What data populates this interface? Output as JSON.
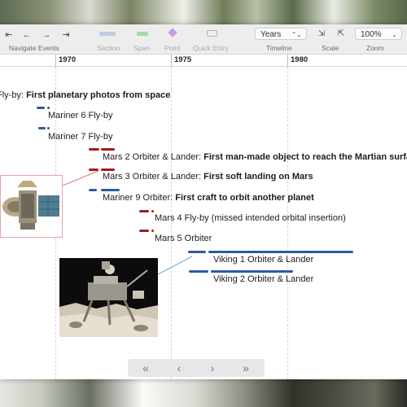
{
  "toolbar": {
    "navigate_label": "Navigate Events",
    "section_label": "Section",
    "span_label": "Span",
    "point_label": "Point",
    "quick_entry_label": "Quick Entry",
    "timeline_label": "Timeline",
    "scale_label": "Scale",
    "zoom_label": "Zoom",
    "timeline_value": "Years",
    "zoom_value": "100%",
    "colors": {
      "span": "#a8d8a8",
      "point": "#c79be0",
      "section": "#b9c6e8"
    }
  },
  "ruler": {
    "years": [
      "1970",
      "1975",
      "1980"
    ]
  },
  "events": [
    {
      "id": "e1",
      "prefix": "Fly-by: ",
      "bold": "First planetary photos from space",
      "color": ""
    },
    {
      "id": "e2",
      "label": "Mariner 6 Fly-by",
      "color": "blue"
    },
    {
      "id": "e3",
      "label": "Mariner 7 Fly-by",
      "color": "blue"
    },
    {
      "id": "e4",
      "prefix": "Mars 2 Orbiter & Lander: ",
      "bold": "First man-made object to reach the Martian surface",
      "color": "red"
    },
    {
      "id": "e5",
      "prefix": "Mars 3 Orbiter & Lander: ",
      "bold": "First soft landing on Mars",
      "color": "red"
    },
    {
      "id": "e6",
      "prefix": "Mariner 9 Orbiter: ",
      "bold": "First craft to orbit another planet",
      "color": "blue"
    },
    {
      "id": "e7",
      "label": "Mars 4 Fly-by (missed intended orbital insertion)",
      "color": "red"
    },
    {
      "id": "e8",
      "label": "Mars 5 Orbiter",
      "color": "red"
    },
    {
      "id": "e9",
      "label": "Viking 1 Orbiter & Lander",
      "color": "blue"
    },
    {
      "id": "e10",
      "label": "Viking 2 Orbiter & Lander",
      "color": "blue"
    }
  ],
  "navigation": {
    "first": "«",
    "prev": "‹",
    "next": "›",
    "last": "»"
  }
}
